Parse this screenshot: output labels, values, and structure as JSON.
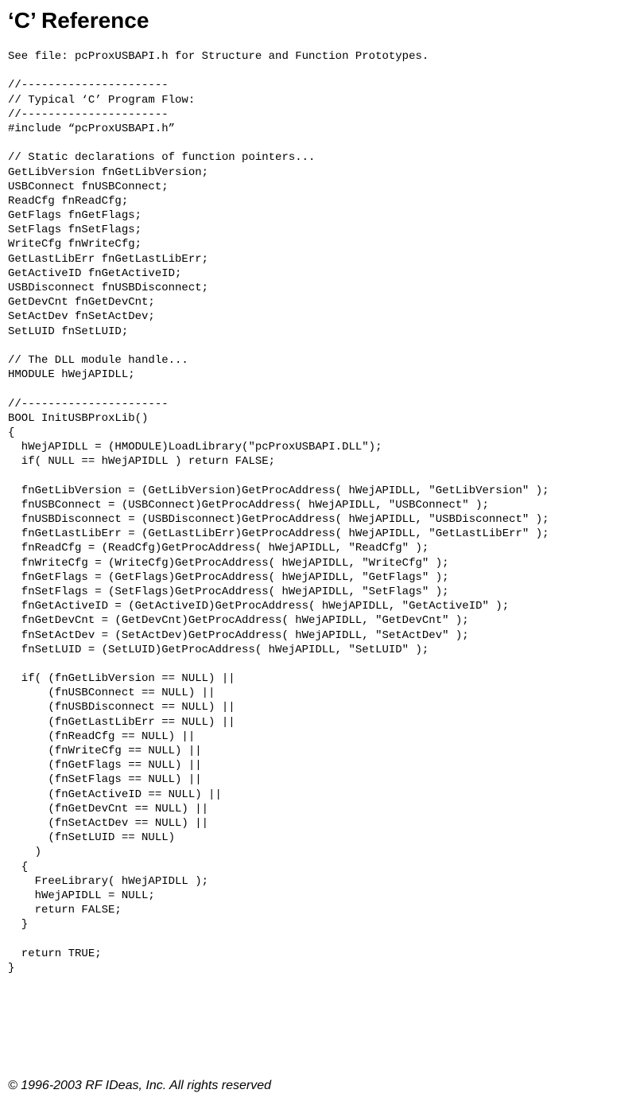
{
  "title": "‘C’ Reference",
  "code": "See file: pcProxUSBAPI.h for Structure and Function Prototypes.\n\n//----------------------\n// Typical ‘C’ Program Flow:\n//----------------------\n#include “pcProxUSBAPI.h”\n\n// Static declarations of function pointers...\nGetLibVersion fnGetLibVersion;\nUSBConnect fnUSBConnect;\nReadCfg fnReadCfg;\nGetFlags fnGetFlags;\nSetFlags fnSetFlags;\nWriteCfg fnWriteCfg;\nGetLastLibErr fnGetLastLibErr;\nGetActiveID fnGetActiveID;\nUSBDisconnect fnUSBDisconnect;\nGetDevCnt fnGetDevCnt;\nSetActDev fnSetActDev;\nSetLUID fnSetLUID;\n\n// The DLL module handle...\nHMODULE hWejAPIDLL;\n\n//----------------------\nBOOL InitUSBProxLib()\n{\n  hWejAPIDLL = (HMODULE)LoadLibrary(\"pcProxUSBAPI.DLL\");\n  if( NULL == hWejAPIDLL ) return FALSE;\n\n  fnGetLibVersion = (GetLibVersion)GetProcAddress( hWejAPIDLL, \"GetLibVersion\" );\n  fnUSBConnect = (USBConnect)GetProcAddress( hWejAPIDLL, \"USBConnect\" );\n  fnUSBDisconnect = (USBDisconnect)GetProcAddress( hWejAPIDLL, \"USBDisconnect\" );\n  fnGetLastLibErr = (GetLastLibErr)GetProcAddress( hWejAPIDLL, \"GetLastLibErr\" );\n  fnReadCfg = (ReadCfg)GetProcAddress( hWejAPIDLL, \"ReadCfg\" );\n  fnWriteCfg = (WriteCfg)GetProcAddress( hWejAPIDLL, \"WriteCfg\" );\n  fnGetFlags = (GetFlags)GetProcAddress( hWejAPIDLL, \"GetFlags\" );\n  fnSetFlags = (SetFlags)GetProcAddress( hWejAPIDLL, \"SetFlags\" );\n  fnGetActiveID = (GetActiveID)GetProcAddress( hWejAPIDLL, \"GetActiveID\" );\n  fnGetDevCnt = (GetDevCnt)GetProcAddress( hWejAPIDLL, \"GetDevCnt\" );\n  fnSetActDev = (SetActDev)GetProcAddress( hWejAPIDLL, \"SetActDev\" );\n  fnSetLUID = (SetLUID)GetProcAddress( hWejAPIDLL, \"SetLUID\" );\n\n  if( (fnGetLibVersion == NULL) ||\n      (fnUSBConnect == NULL) ||\n      (fnUSBDisconnect == NULL) ||\n      (fnGetLastLibErr == NULL) ||\n      (fnReadCfg == NULL) ||\n      (fnWriteCfg == NULL) ||\n      (fnGetFlags == NULL) ||\n      (fnSetFlags == NULL) ||\n      (fnGetActiveID == NULL) ||\n      (fnGetDevCnt == NULL) ||\n      (fnSetActDev == NULL) ||\n      (fnSetLUID == NULL)\n    )\n  {\n    FreeLibrary( hWejAPIDLL );\n    hWejAPIDLL = NULL;\n    return FALSE;\n  }\n\n  return TRUE;\n}",
  "footer": "© 1996-2003 RF IDeas, Inc. All rights reserved"
}
